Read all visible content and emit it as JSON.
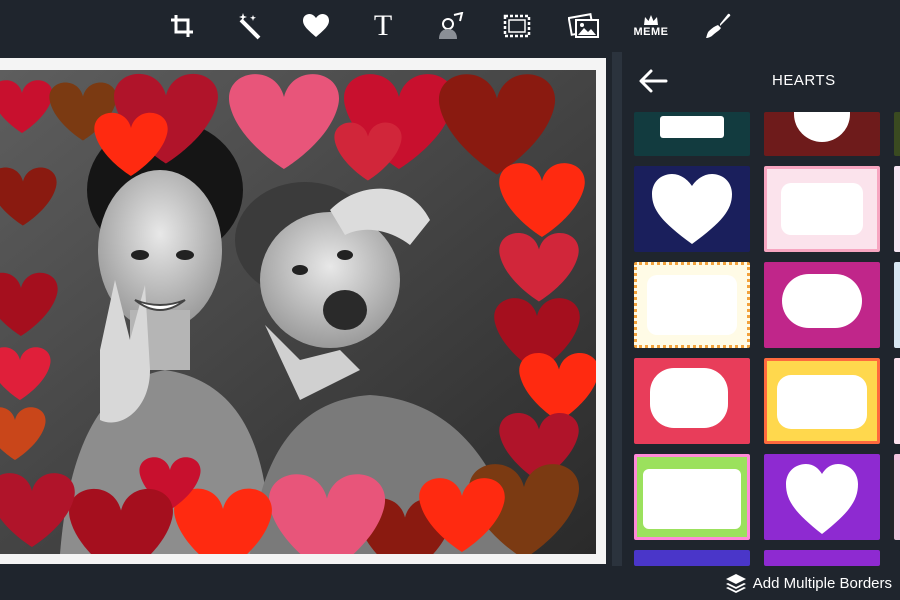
{
  "toolbar": {
    "tools": [
      {
        "name": "crop-icon"
      },
      {
        "name": "magic-wand-icon"
      },
      {
        "name": "heart-icon"
      },
      {
        "name": "text-icon",
        "label": "T"
      },
      {
        "name": "sticker-icon"
      },
      {
        "name": "frame-icon"
      },
      {
        "name": "photos-icon"
      },
      {
        "name": "meme-icon",
        "label": "MEME"
      },
      {
        "name": "brush-icon"
      }
    ]
  },
  "panel": {
    "title": "HEARTS",
    "back_icon": "arrow-left-icon"
  },
  "bottombar": {
    "add_label": "Add Multiple Borders",
    "icon": "layers-icon"
  },
  "colors": {
    "background": "#1f252d",
    "divider": "#2b333d"
  }
}
